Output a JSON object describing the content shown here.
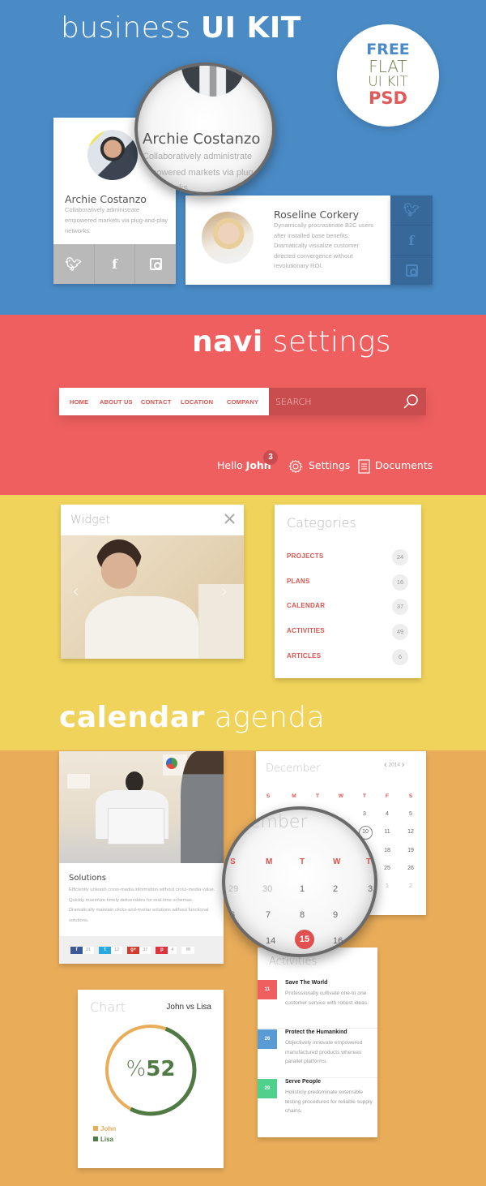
{
  "colors": {
    "blue_band": "#4a8bc6",
    "red_band": "#ef5f5f",
    "yellow_band": "#f0d35a",
    "orange_band": "#e9ad5a",
    "accent_red": "#d9534f",
    "john_color": "#e9ad5a",
    "lisa_color": "#4f7a43"
  },
  "header": {
    "title_light": "business",
    "title_bold": "UI KIT"
  },
  "badge": {
    "line1": "FREE",
    "line2": "FLAT",
    "line3": "UI KIT",
    "line4": "PSD"
  },
  "profiles": [
    {
      "name": "Archie Costanzo",
      "description": "Collaboratively administrate empowered markets via plug-and-play networks.",
      "social": [
        "twitter-icon",
        "facebook-icon",
        "instagram-icon"
      ]
    },
    {
      "name": "Roseline Corkery",
      "description": "Dynamically procrastinate B2C users after installed base benefits. Dramatically visualize customer directed convergence without revolutionary ROI.",
      "social": [
        "twitter-icon",
        "facebook-icon",
        "instagram-icon"
      ]
    }
  ],
  "magnifier_top": {
    "name": "Archie Costanzo",
    "line1": "Collaboratively administrate",
    "line2": "empowered markets via plug-",
    "line3": "networks."
  },
  "navi": {
    "heading_bold": "navi",
    "heading_light": "settings",
    "links": [
      "HOME",
      "ABOUT US",
      "CONTACT",
      "LOCATION",
      "COMPANY"
    ],
    "search_placeholder": "SEARCH",
    "greeting": "Hello",
    "user": "John",
    "notifications": "3",
    "settings_label": "Settings",
    "documents_label": "Documents"
  },
  "widget": {
    "title": "Widget",
    "prev": "‹",
    "next": "›"
  },
  "categories": {
    "title": "Categories",
    "items": [
      {
        "label": "PROJECTS",
        "count": "24"
      },
      {
        "label": "PLANS",
        "count": "16"
      },
      {
        "label": "CALENDAR",
        "count": "37"
      },
      {
        "label": "ACTIVITIES",
        "count": "49"
      },
      {
        "label": "ARTICLES",
        "count": "6"
      }
    ]
  },
  "calendar_heading": {
    "bold": "calendar",
    "light": "agenda"
  },
  "solutions": {
    "title": "Solutions",
    "text": "Efficiently unleash cross-media information without cross-media value. Quickly maximize timely deliverables for real-time schemas. Dramatically maintain clicks-and-mortar solutions without functional solutions.",
    "shares": [
      {
        "network": "facebook",
        "icon": "f",
        "count": "21",
        "color": "#3b5998"
      },
      {
        "network": "twitter",
        "icon": "t",
        "count": "12",
        "color": "#29a9e1"
      },
      {
        "network": "google-plus",
        "icon": "g+",
        "count": "37",
        "color": "#d23a2b"
      },
      {
        "network": "pinterest",
        "icon": "p",
        "count": "4",
        "color": "#e0323e"
      },
      {
        "network": "email",
        "icon": "✉",
        "count": "",
        "color": "#e8e8e8"
      }
    ]
  },
  "calendar": {
    "month": "December",
    "year": "2014",
    "prev": "‹",
    "next": "›",
    "weekdays": [
      "S",
      "M",
      "T",
      "W",
      "T",
      "F",
      "S"
    ],
    "visible_days_right": {
      "row1": [
        "3",
        "4",
        "5"
      ],
      "row2": [
        "10",
        "11",
        "12"
      ],
      "row3": [
        "18",
        "19"
      ],
      "row4": [
        "25",
        "26"
      ],
      "row5": [
        "1",
        "2"
      ]
    },
    "today": "10",
    "magnified": {
      "month_fragment": "ember",
      "weekdays": [
        "S",
        "M",
        "T",
        "W",
        "T"
      ],
      "row1": [
        "29",
        "30",
        "1",
        "2",
        "3"
      ],
      "row2": [
        "6",
        "7",
        "8",
        "9"
      ],
      "row3": [
        "14",
        "15",
        "16"
      ],
      "selected": "15"
    }
  },
  "activities": {
    "title": "Activities",
    "items": [
      {
        "day": "11",
        "color": "#ef5f5f",
        "title": "Save The World",
        "text": "Professionally cultivate one-to one customer service with robust ideas."
      },
      {
        "day": "26",
        "color": "#5b9bd5",
        "title": "Protect the Humankind",
        "text": "Objectively innovate empowered manufactured products whereas parallel platforms."
      },
      {
        "day": "29",
        "color": "#4fd08c",
        "title": "Serve People",
        "text": "Holisticly predominate extensible testing procedures for reliable supply chains."
      }
    ]
  },
  "chart_data": {
    "type": "pie",
    "title": "Chart",
    "subtitle": "John vs Lisa",
    "center_label_prefix": "%",
    "center_label_value": "52",
    "series": [
      {
        "name": "John",
        "value": 48,
        "color": "#e9ad5a"
      },
      {
        "name": "Lisa",
        "value": 52,
        "color": "#4f7a43"
      }
    ],
    "legend": "bottom-left"
  }
}
